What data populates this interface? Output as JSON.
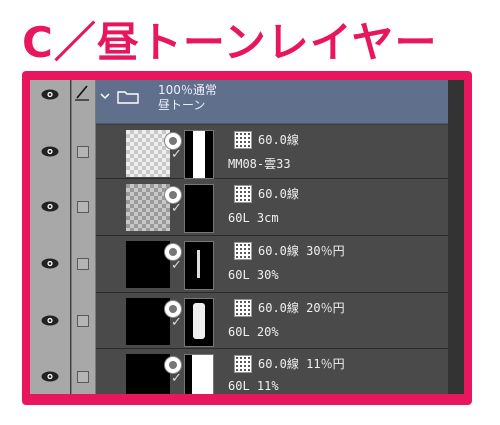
{
  "title": "C／昼トーンレイヤー",
  "folder": {
    "chevron": "chevron-down-icon",
    "icon": "folder-icon",
    "opacity_mode": "100％通常",
    "name": "昼トーン"
  },
  "layers": [
    {
      "tone": "60.0線",
      "name": "MM08-雲33",
      "thumb": "checker",
      "mask": "white-bar"
    },
    {
      "tone": "60.0線",
      "name": "60L 3cm",
      "thumb": "checker",
      "mask": "black"
    },
    {
      "tone": "60.0線 30％円",
      "name": "60L 30%",
      "thumb": "black",
      "mask": "dots"
    },
    {
      "tone": "60.0線 20％円",
      "name": "60L 20%",
      "thumb": "black",
      "mask": "dots"
    },
    {
      "tone": "60.0線 11％円",
      "name": "60L 11%",
      "thumb": "black",
      "mask": "dots"
    }
  ],
  "colors": {
    "accent": "#e8175d",
    "folder_row": "#5f6f8c",
    "layer_row": "#4a4a4a",
    "side_columns": "#a8a8a8"
  }
}
